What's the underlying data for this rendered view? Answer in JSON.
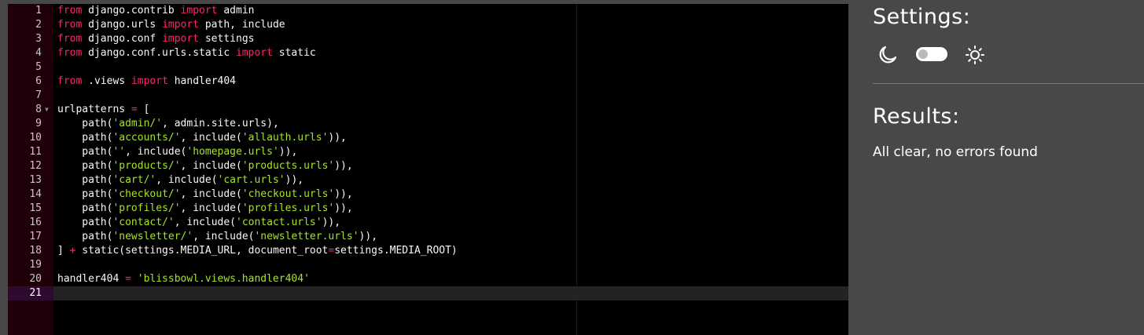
{
  "editor": {
    "active_line": 21,
    "lines": [
      {
        "num": "1",
        "tokens": [
          {
            "t": "from",
            "c": "kw"
          },
          {
            "t": " django.contrib ",
            "c": ""
          },
          {
            "t": "import",
            "c": "kw"
          },
          {
            "t": " admin",
            "c": ""
          }
        ]
      },
      {
        "num": "2",
        "tokens": [
          {
            "t": "from",
            "c": "kw"
          },
          {
            "t": " django.urls ",
            "c": ""
          },
          {
            "t": "import",
            "c": "kw"
          },
          {
            "t": " path, include",
            "c": ""
          }
        ]
      },
      {
        "num": "3",
        "tokens": [
          {
            "t": "from",
            "c": "kw"
          },
          {
            "t": " django.conf ",
            "c": ""
          },
          {
            "t": "import",
            "c": "kw"
          },
          {
            "t": " settings",
            "c": ""
          }
        ]
      },
      {
        "num": "4",
        "tokens": [
          {
            "t": "from",
            "c": "kw"
          },
          {
            "t": " django.conf.urls.static ",
            "c": ""
          },
          {
            "t": "import",
            "c": "kw"
          },
          {
            "t": " static",
            "c": ""
          }
        ]
      },
      {
        "num": "5",
        "tokens": []
      },
      {
        "num": "6",
        "tokens": [
          {
            "t": "from",
            "c": "kw"
          },
          {
            "t": " .views ",
            "c": ""
          },
          {
            "t": "import",
            "c": "kw"
          },
          {
            "t": " handler404",
            "c": ""
          }
        ]
      },
      {
        "num": "7",
        "tokens": []
      },
      {
        "num": "8",
        "fold": true,
        "tokens": [
          {
            "t": "urlpatterns ",
            "c": ""
          },
          {
            "t": "=",
            "c": "op"
          },
          {
            "t": " [",
            "c": ""
          }
        ]
      },
      {
        "num": "9",
        "tokens": [
          {
            "t": "    path(",
            "c": ""
          },
          {
            "t": "'admin/'",
            "c": "str"
          },
          {
            "t": ", admin.site.urls),",
            "c": ""
          }
        ]
      },
      {
        "num": "10",
        "tokens": [
          {
            "t": "    path(",
            "c": ""
          },
          {
            "t": "'accounts/'",
            "c": "str"
          },
          {
            "t": ", include(",
            "c": ""
          },
          {
            "t": "'allauth.urls'",
            "c": "str"
          },
          {
            "t": ")),",
            "c": ""
          }
        ]
      },
      {
        "num": "11",
        "tokens": [
          {
            "t": "    path(",
            "c": ""
          },
          {
            "t": "''",
            "c": "str"
          },
          {
            "t": ", include(",
            "c": ""
          },
          {
            "t": "'homepage.urls'",
            "c": "str"
          },
          {
            "t": ")),",
            "c": ""
          }
        ]
      },
      {
        "num": "12",
        "tokens": [
          {
            "t": "    path(",
            "c": ""
          },
          {
            "t": "'products/'",
            "c": "str"
          },
          {
            "t": ", include(",
            "c": ""
          },
          {
            "t": "'products.urls'",
            "c": "str"
          },
          {
            "t": ")),",
            "c": ""
          }
        ]
      },
      {
        "num": "13",
        "tokens": [
          {
            "t": "    path(",
            "c": ""
          },
          {
            "t": "'cart/'",
            "c": "str"
          },
          {
            "t": ", include(",
            "c": ""
          },
          {
            "t": "'cart.urls'",
            "c": "str"
          },
          {
            "t": ")),",
            "c": ""
          }
        ]
      },
      {
        "num": "14",
        "tokens": [
          {
            "t": "    path(",
            "c": ""
          },
          {
            "t": "'checkout/'",
            "c": "str"
          },
          {
            "t": ", include(",
            "c": ""
          },
          {
            "t": "'checkout.urls'",
            "c": "str"
          },
          {
            "t": ")),",
            "c": ""
          }
        ]
      },
      {
        "num": "15",
        "tokens": [
          {
            "t": "    path(",
            "c": ""
          },
          {
            "t": "'profiles/'",
            "c": "str"
          },
          {
            "t": ", include(",
            "c": ""
          },
          {
            "t": "'profiles.urls'",
            "c": "str"
          },
          {
            "t": ")),",
            "c": ""
          }
        ]
      },
      {
        "num": "16",
        "tokens": [
          {
            "t": "    path(",
            "c": ""
          },
          {
            "t": "'contact/'",
            "c": "str"
          },
          {
            "t": ", include(",
            "c": ""
          },
          {
            "t": "'contact.urls'",
            "c": "str"
          },
          {
            "t": ")),",
            "c": ""
          }
        ]
      },
      {
        "num": "17",
        "tokens": [
          {
            "t": "    path(",
            "c": ""
          },
          {
            "t": "'newsletter/'",
            "c": "str"
          },
          {
            "t": ", include(",
            "c": ""
          },
          {
            "t": "'newsletter.urls'",
            "c": "str"
          },
          {
            "t": ")),",
            "c": ""
          }
        ]
      },
      {
        "num": "18",
        "tokens": [
          {
            "t": "] ",
            "c": ""
          },
          {
            "t": "+",
            "c": "op"
          },
          {
            "t": " static(settings.MEDIA_URL, document_root",
            "c": ""
          },
          {
            "t": "=",
            "c": "op"
          },
          {
            "t": "settings.MEDIA_ROOT)",
            "c": ""
          }
        ]
      },
      {
        "num": "19",
        "tokens": []
      },
      {
        "num": "20",
        "tokens": [
          {
            "t": "handler404 ",
            "c": ""
          },
          {
            "t": "=",
            "c": "op"
          },
          {
            "t": " ",
            "c": ""
          },
          {
            "t": "'blissbowl.views.handler404'",
            "c": "str"
          }
        ]
      },
      {
        "num": "21",
        "tokens": []
      }
    ]
  },
  "settings": {
    "title": "Settings:",
    "dark_icon": "moon-icon",
    "light_icon": "sun-icon",
    "theme_toggle_on": false
  },
  "results": {
    "title": "Results:",
    "message": "All clear, no errors found"
  },
  "colors": {
    "editor_bg": "#000000",
    "gutter_bg": "#1f0008",
    "panel_bg": "#484848",
    "keyword": "#f92672",
    "string": "#a6e22e",
    "text": "#f8f8f2"
  }
}
